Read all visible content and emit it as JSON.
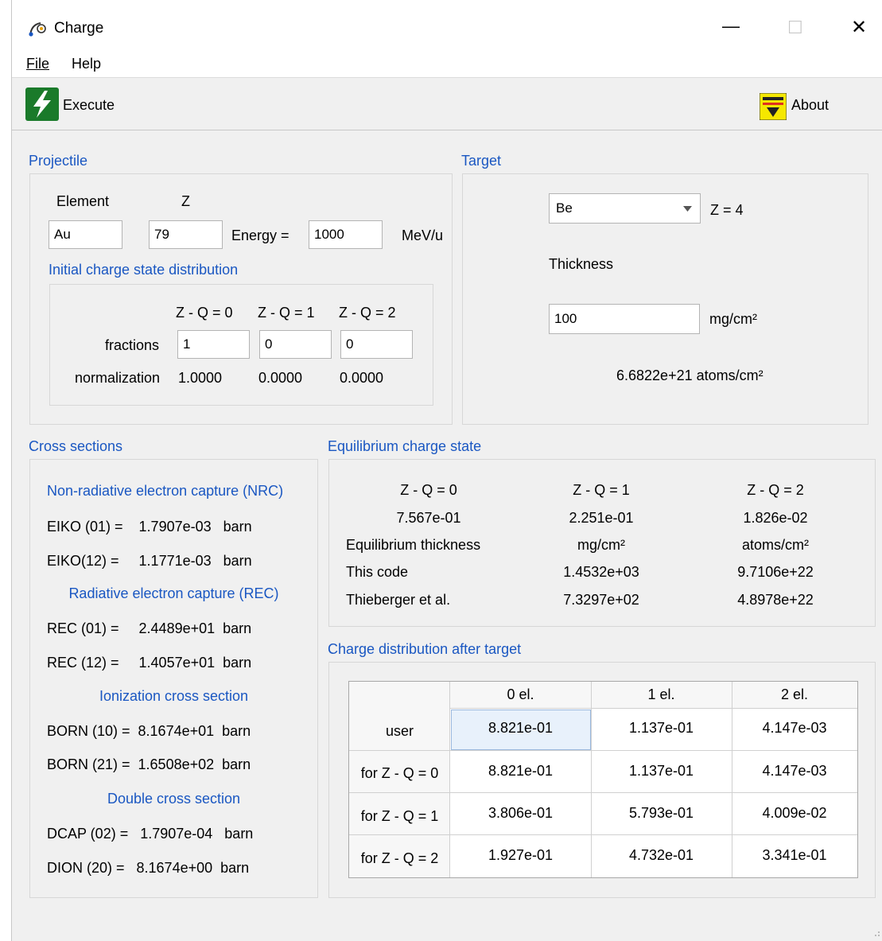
{
  "window": {
    "title": "Charge",
    "minimize_glyph": "—",
    "maximize_glyph": "☐",
    "close_glyph": "✕"
  },
  "menu": {
    "file": "File",
    "help": "Help"
  },
  "toolbar": {
    "execute_label": "Execute",
    "about_label": "About",
    "execute_icon": "lightning-icon",
    "about_icon": "about-icon"
  },
  "projectile": {
    "title": "Projectile",
    "element_label": "Element",
    "z_label": "Z",
    "element_value": "Au",
    "z_value": "79",
    "energy_label": "Energy =",
    "energy_value": "1000",
    "energy_unit": "MeV/u",
    "initial_title": "Initial charge state distribution",
    "col_headers": [
      "Z - Q = 0",
      "Z - Q = 1",
      "Z - Q = 2"
    ],
    "fractions_label": "fractions",
    "fractions": [
      "1",
      "0",
      "0"
    ],
    "normalization_label": "normalization",
    "normalization": [
      "1.0000",
      "0.0000",
      "0.0000"
    ]
  },
  "target": {
    "title": "Target",
    "element": "Be",
    "z_text": "Z = 4",
    "thickness_label": "Thickness",
    "thickness_value": "100",
    "thickness_unit": "mg/cm²",
    "atoms_text": "6.6822e+21  atoms/cm²"
  },
  "cross_sections": {
    "title": "Cross sections",
    "nrc_title": "Non-radiative electron capture (NRC)",
    "eiko01": "EIKO (01) =    1.7907e-03   barn",
    "eiko12": "EIKO(12) =     1.1771e-03   barn",
    "rec_title": "Radiative electron capture (REC)",
    "rec01": "REC (01) =     2.4489e+01  barn",
    "rec12": "REC (12) =     1.4057e+01  barn",
    "ion_title": "Ionization cross section",
    "born10": "BORN (10) =  8.1674e+01  barn",
    "born21": "BORN (21) =  1.6508e+02  barn",
    "double_title": "Double cross section",
    "dcap02": "DCAP (02) =   1.7907e-04   barn",
    "dion20": "DION (20) =   8.1674e+00  barn"
  },
  "equilibrium": {
    "title": "Equilibrium charge state",
    "headers": [
      "Z - Q = 0",
      "Z - Q = 1",
      "Z - Q = 2"
    ],
    "values": [
      "7.567e-01",
      "2.251e-01",
      "1.826e-02"
    ],
    "thickness_label": "Equilibrium thickness",
    "unit_mg": "mg/cm²",
    "unit_atoms": "atoms/cm²",
    "this_code_label": "This code",
    "this_code_mg": "1.4532e+03",
    "this_code_atoms": "9.7106e+22",
    "thieberger_label": "Thieberger et al.",
    "thieberger_mg": "7.3297e+02",
    "thieberger_atoms": "4.8978e+22"
  },
  "distribution": {
    "title": "Charge distribution after target",
    "col_headers": [
      "0 el.",
      "1 el.",
      "2 el."
    ],
    "rows": [
      {
        "label": "user",
        "values": [
          "8.821e-01",
          "1.137e-01",
          "4.147e-03"
        ]
      },
      {
        "label": "for Z - Q = 0",
        "values": [
          "8.821e-01",
          "1.137e-01",
          "4.147e-03"
        ]
      },
      {
        "label": "for Z - Q = 1",
        "values": [
          "3.806e-01",
          "5.793e-01",
          "4.009e-02"
        ]
      },
      {
        "label": "for Z - Q = 2",
        "values": [
          "1.927e-01",
          "4.732e-01",
          "3.341e-01"
        ]
      }
    ]
  }
}
